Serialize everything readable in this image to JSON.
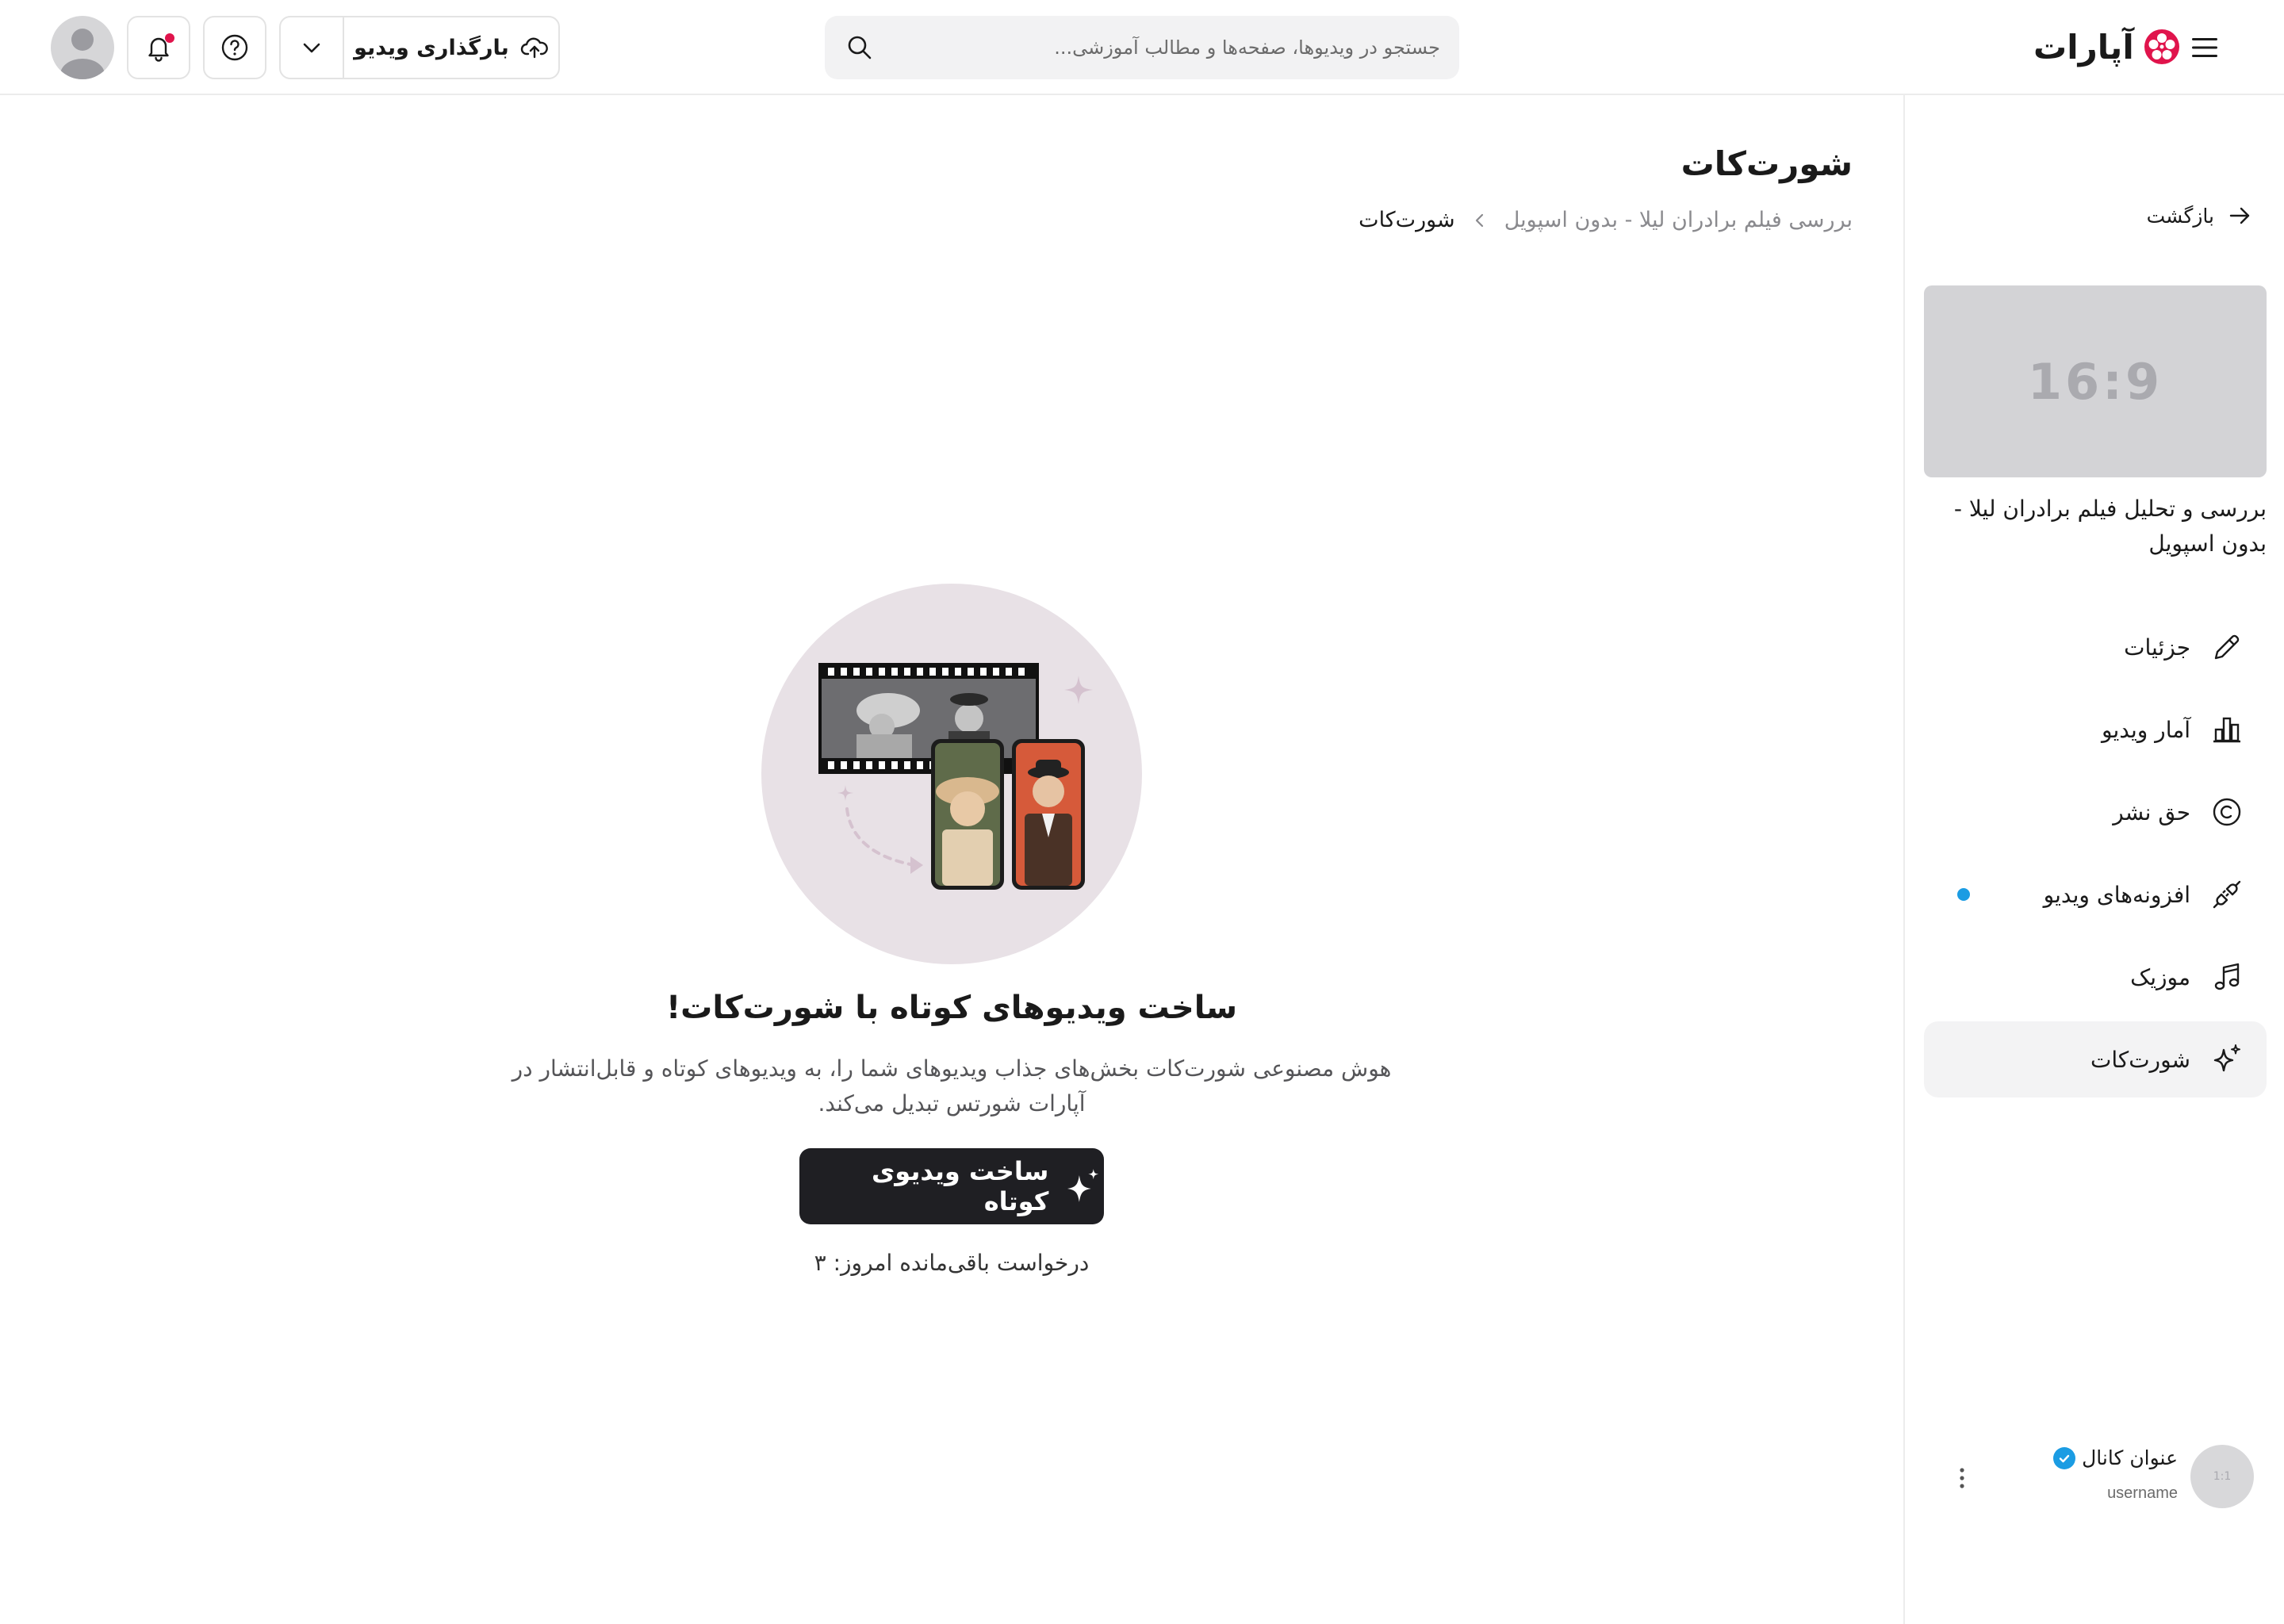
{
  "header": {
    "logo_text": "آپارات",
    "search_placeholder": "جستجو در ویدیوها، صفحه‌ها و مطالب آموزشی...",
    "upload_label": "بارگذاری ویدیو",
    "notification_indicator_color": "#e0144c"
  },
  "sidebar": {
    "back_label": "بازگشت",
    "thumbnail_ratio": "16:9",
    "video_title": "بررسی و تحلیل فیلم برادران لیلا - بدون اسپویل",
    "items": [
      {
        "label": "جزئیات",
        "icon": "pencil-icon"
      },
      {
        "label": "آمار ویدیو",
        "icon": "bar-chart-icon"
      },
      {
        "label": "حق نشر",
        "icon": "copyright-icon"
      },
      {
        "label": "افزونه‌های ویدیو",
        "icon": "plugin-icon",
        "has_dot": true
      },
      {
        "label": "موزیک",
        "icon": "music-icon"
      },
      {
        "label": "شورت‌کات",
        "icon": "sparkle-icon",
        "active": true
      }
    ],
    "channel": {
      "avatar_ratio": "1:1",
      "name": "عنوان کانال",
      "username": "username",
      "verified": true
    }
  },
  "main": {
    "title": "شورت‌کات",
    "breadcrumb": {
      "parent": "بررسی فیلم برادران لیلا - بدون اسپویل",
      "current": "شورت‌کات"
    },
    "empty_state": {
      "title": "ساخت ویدیوهای کوتاه با شورت‌کات!",
      "description": "هوش مصنوعی شورت‌کات بخش‌های جذاب ویدیوهای شما را، به ویدیوهای کوتاه و قابل‌انتشار در آپارات شورتس تبدیل می‌کند.",
      "cta_label": "ساخت ویدیوی کوتاه",
      "remaining": "درخواست باقی‌مانده امروز: ۳"
    }
  },
  "colors": {
    "accent_dark": "#1f1f23",
    "brand_red": "#e0144c",
    "dot_blue": "#1b9ce3"
  }
}
